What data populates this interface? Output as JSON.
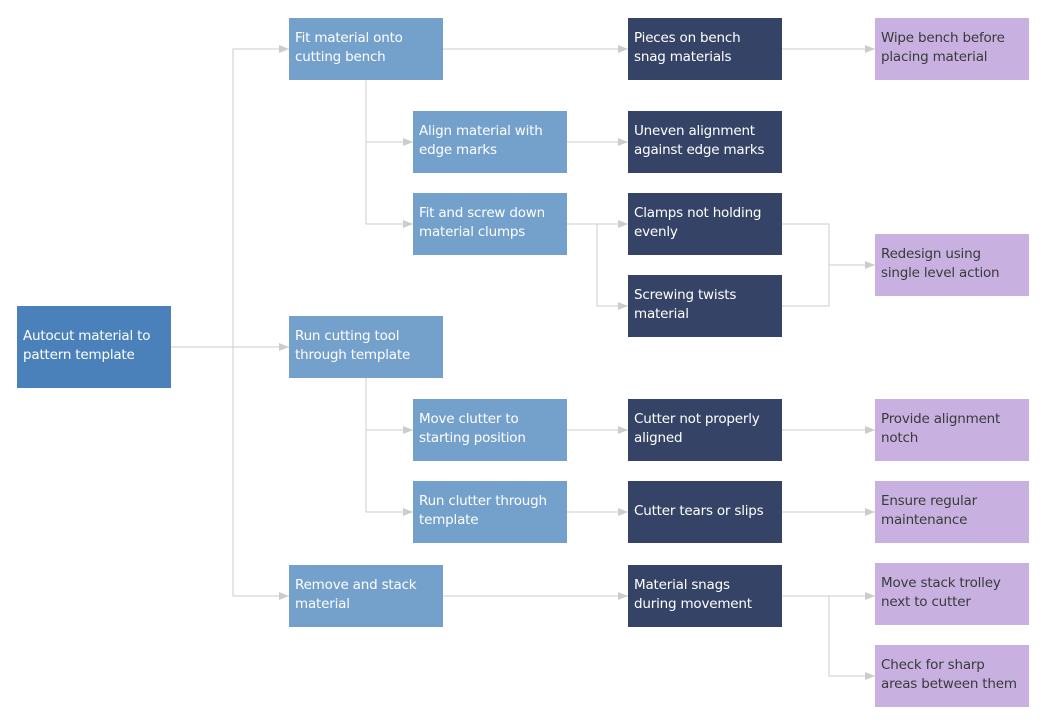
{
  "diagram": {
    "type": "fault-tree / failure-mode analysis",
    "colors": {
      "root": "#4a81bb",
      "step": "#74a0cc",
      "cause": "#354466",
      "solution": "#c8b1e0",
      "connector": "#cccccc"
    },
    "root": {
      "id": "root",
      "label": "Autocut material to pattern template"
    },
    "steps": [
      {
        "id": "s1",
        "label": "Fit material onto cutting bench"
      },
      {
        "id": "s1a",
        "label": "Align material with edge marks"
      },
      {
        "id": "s1b",
        "label": "Fit and screw down material clumps"
      },
      {
        "id": "s2",
        "label": "Run cutting tool through template"
      },
      {
        "id": "s2a",
        "label": "Move clutter to starting position"
      },
      {
        "id": "s2b",
        "label": "Run clutter through template"
      },
      {
        "id": "s3",
        "label": "Remove and stack material"
      }
    ],
    "causes": [
      {
        "id": "c1",
        "label": "Pieces on bench snag materials"
      },
      {
        "id": "c2",
        "label": "Uneven alignment against edge marks"
      },
      {
        "id": "c3",
        "label": "Clamps not holding evenly"
      },
      {
        "id": "c4",
        "label": "Screwing twists material"
      },
      {
        "id": "c5",
        "label": "Cutter not properly aligned"
      },
      {
        "id": "c6",
        "label": "Cutter tears or slips"
      },
      {
        "id": "c7",
        "label": "Material snags during movement"
      }
    ],
    "solutions": [
      {
        "id": "f1",
        "label": "Wipe bench before placing material"
      },
      {
        "id": "f2",
        "label": "Redesign using single level action"
      },
      {
        "id": "f3",
        "label": "Provide alignment notch"
      },
      {
        "id": "f4",
        "label": "Ensure regular maintenance"
      },
      {
        "id": "f5",
        "label": "Move stack trolley next to cutter"
      },
      {
        "id": "f6",
        "label": "Check for sharp areas between them"
      }
    ],
    "connections": [
      [
        "root",
        "s1"
      ],
      [
        "root",
        "s2"
      ],
      [
        "root",
        "s3"
      ],
      [
        "s1",
        "s1a"
      ],
      [
        "s1",
        "s1b"
      ],
      [
        "s2",
        "s2a"
      ],
      [
        "s2",
        "s2b"
      ],
      [
        "s1",
        "c1"
      ],
      [
        "s1a",
        "c2"
      ],
      [
        "s1b",
        "c3"
      ],
      [
        "s1b",
        "c4"
      ],
      [
        "s2a",
        "c5"
      ],
      [
        "s2b",
        "c6"
      ],
      [
        "s3",
        "c7"
      ],
      [
        "c1",
        "f1"
      ],
      [
        "c3",
        "f2"
      ],
      [
        "c4",
        "f2"
      ],
      [
        "c5",
        "f3"
      ],
      [
        "c6",
        "f4"
      ],
      [
        "c7",
        "f5"
      ],
      [
        "c7",
        "f6"
      ]
    ]
  }
}
